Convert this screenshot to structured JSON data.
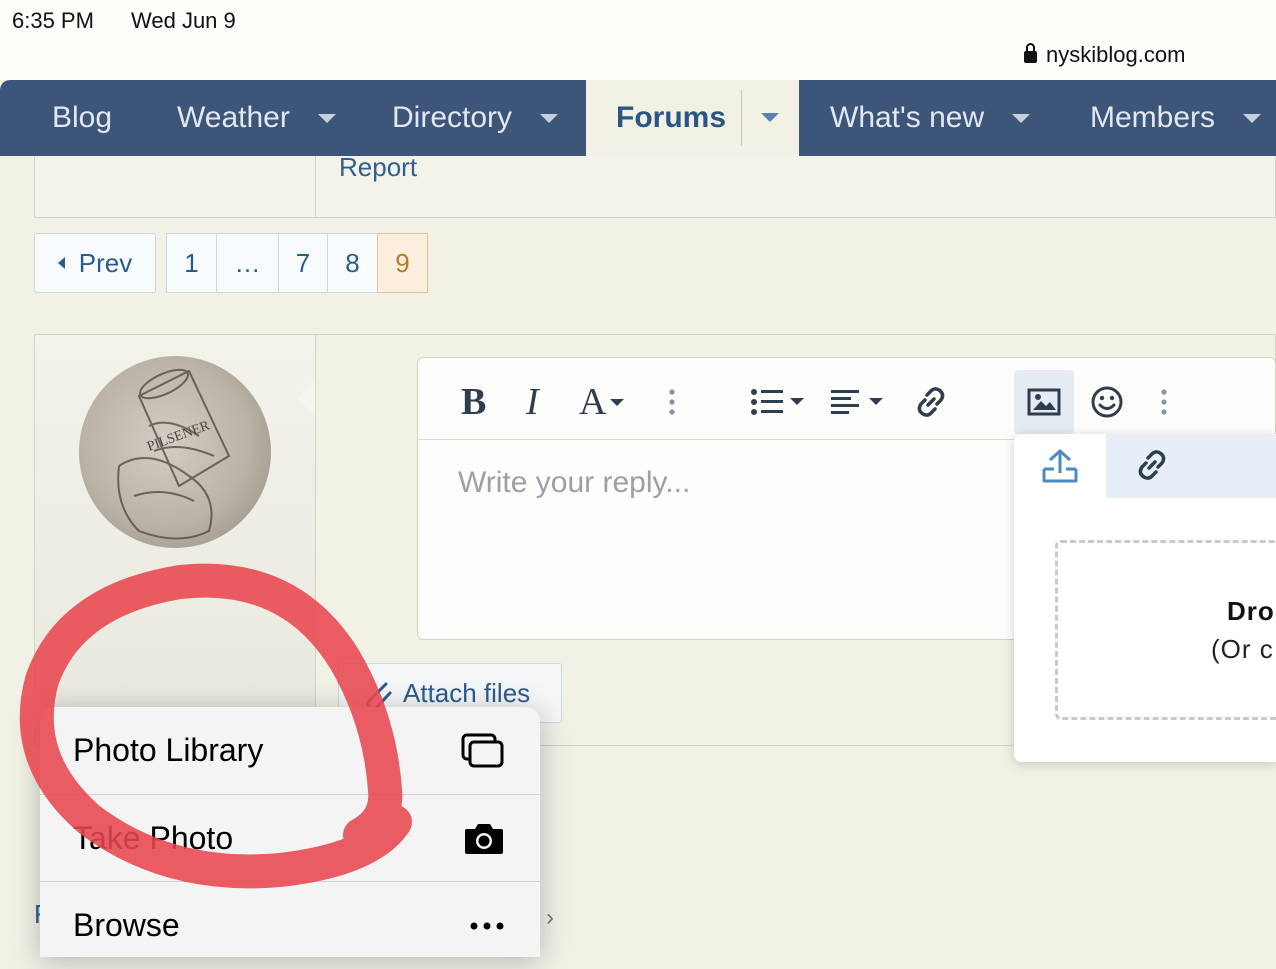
{
  "status_bar": {
    "time": "6:35 PM",
    "date": "Wed Jun 9",
    "url": "nyskiblog.com"
  },
  "nav": {
    "items": [
      {
        "label": "Blog",
        "has_caret": false
      },
      {
        "label": "Weather",
        "has_caret": true
      },
      {
        "label": "Directory",
        "has_caret": true
      },
      {
        "label": "Forums",
        "has_caret": true,
        "active": true
      },
      {
        "label": "What's new",
        "has_caret": true
      },
      {
        "label": "Members",
        "has_caret": true
      }
    ]
  },
  "post": {
    "report_link": "Report"
  },
  "pagination": {
    "prev_label": "Prev",
    "pages": [
      "1",
      "…",
      "7",
      "8",
      "9"
    ],
    "current": "9"
  },
  "editor": {
    "placeholder": "Write your reply...",
    "toolbar_icons": [
      "bold-icon",
      "italic-icon",
      "font-size-icon",
      "more-vertical-icon",
      "list-icon",
      "align-icon",
      "link-icon",
      "image-icon",
      "smiley-icon",
      "more-vertical-icon"
    ]
  },
  "attach_button": {
    "label": "Attach files"
  },
  "image_popup": {
    "tabs": [
      "upload-icon",
      "link-icon"
    ],
    "drop_title": "Dro",
    "drop_subtitle": "(Or c"
  },
  "ios_menu": {
    "items": [
      {
        "label": "Photo Library",
        "icon": "photo-library-icon"
      },
      {
        "label": "Take Photo",
        "icon": "camera-icon"
      },
      {
        "label": "Browse",
        "icon": "ellipsis-icon"
      }
    ]
  },
  "colors": {
    "nav_bg": "#3d5578",
    "page_bg": "#f1f1e6",
    "link": "#2b5b8c",
    "annotation": "#e8474f"
  }
}
